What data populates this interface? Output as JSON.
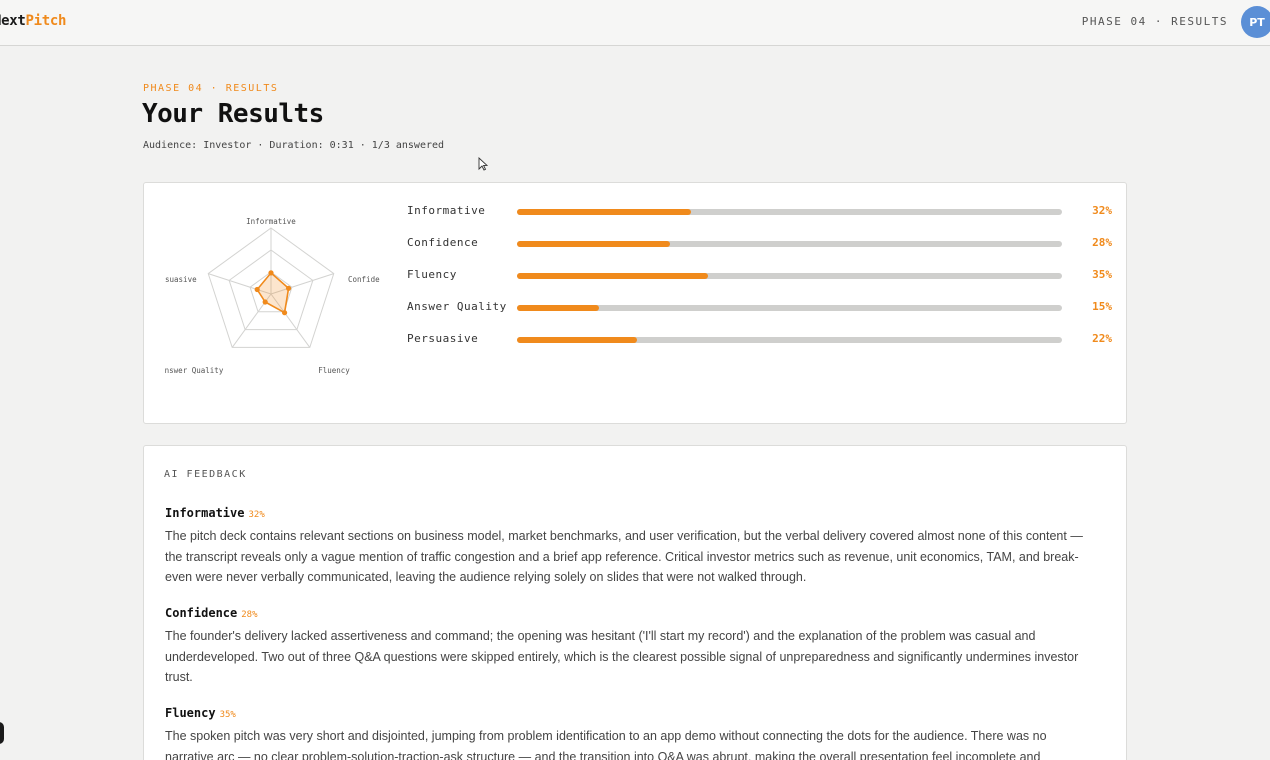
{
  "header": {
    "logo_part1": "Next",
    "logo_part2": "Pitch",
    "phase_nav": "PHASE 04 · RESULTS",
    "avatar_initials": "PT",
    "avatar_color": "#5b8fd6"
  },
  "page": {
    "eyebrow": "PHASE 04 · RESULTS",
    "title": "Your Results",
    "meta": "Audience: Investor · Duration: 0:31 · 1/3 answered"
  },
  "colors": {
    "accent": "#f08a1c",
    "track": "#cfcfcd"
  },
  "chart_data": {
    "type": "radar",
    "axes": [
      "Informative",
      "Confidence",
      "Fluency",
      "Answer Quality",
      "Persuasive"
    ],
    "visible_axis_labels": [
      "Informative",
      "Confide",
      "Fluency",
      "nswer Quality",
      "suasive"
    ],
    "values": [
      32,
      28,
      35,
      15,
      22
    ],
    "range": [
      0,
      100
    ],
    "rings": 3
  },
  "scores": [
    {
      "label": "Informative",
      "value": 32,
      "pct": "32%"
    },
    {
      "label": "Confidence",
      "value": 28,
      "pct": "28%"
    },
    {
      "label": "Fluency",
      "value": 35,
      "pct": "35%"
    },
    {
      "label": "Answer Quality",
      "value": 15,
      "pct": "15%"
    },
    {
      "label": "Persuasive",
      "value": 22,
      "pct": "22%"
    }
  ],
  "feedback": {
    "heading": "AI FEEDBACK",
    "items": [
      {
        "title": "Informative",
        "pct": "32%",
        "text": "The pitch deck contains relevant sections on business model, market benchmarks, and user verification, but the verbal delivery covered almost none of this content — the transcript reveals only a vague mention of traffic congestion and a brief app reference. Critical investor metrics such as revenue, unit economics, TAM, and break-even were never verbally communicated, leaving the audience relying solely on slides that were not walked through."
      },
      {
        "title": "Confidence",
        "pct": "28%",
        "text": "The founder's delivery lacked assertiveness and command; the opening was hesitant ('I'll start my record') and the explanation of the problem was casual and underdeveloped. Two out of three Q&A questions were skipped entirely, which is the clearest possible signal of unpreparedness and significantly undermines investor trust."
      },
      {
        "title": "Fluency",
        "pct": "35%",
        "text": "The spoken pitch was very short and disjointed, jumping from problem identification to an app demo without connecting the dots for the audience. There was no narrative arc — no clear problem-solution-traction-ask structure — and the transition into Q&A was abrupt, making the overall presentation feel incomplete and"
      }
    ]
  }
}
